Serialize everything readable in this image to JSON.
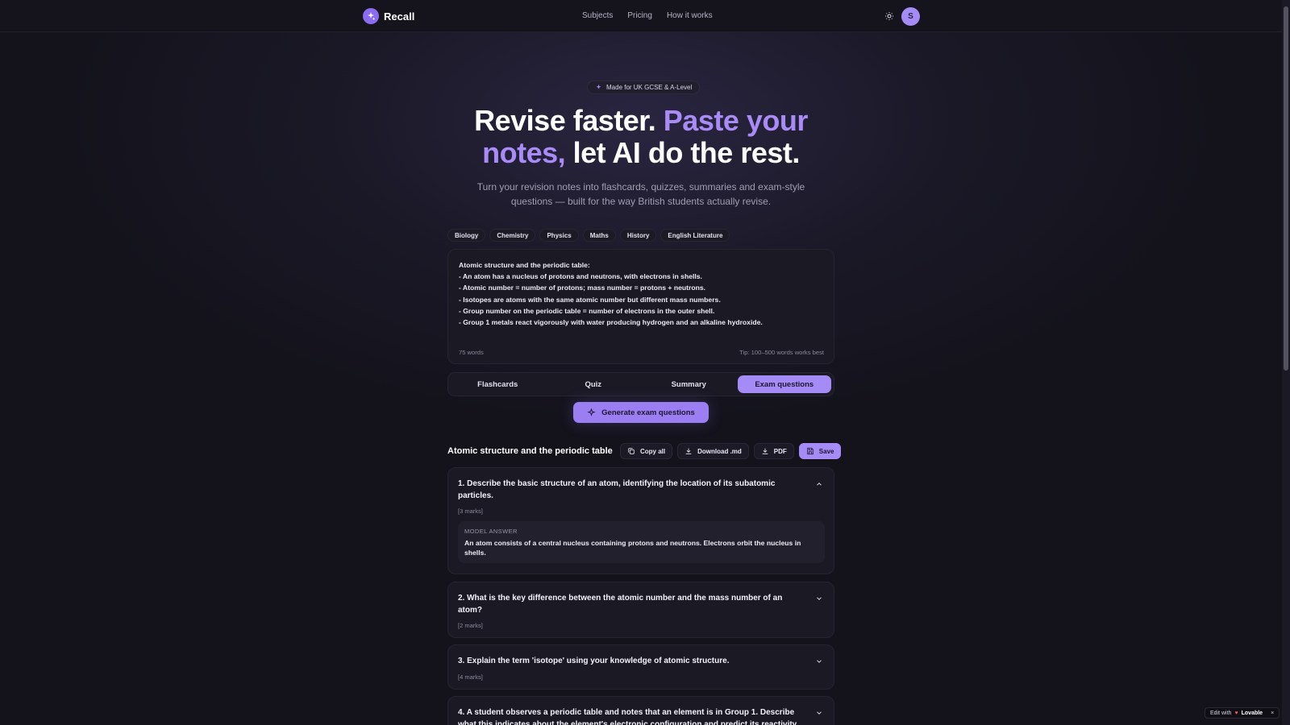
{
  "nav": {
    "brand": "Recall",
    "links": [
      "Subjects",
      "Pricing",
      "How it works"
    ],
    "avatar_initial": "S"
  },
  "hero": {
    "badge": "Made for UK GCSE & A-Level",
    "headline_part1": "Revise faster.",
    "headline_accent": "Paste your notes,",
    "headline_part2": "let AI do the rest.",
    "subhead": "Turn your revision notes into flashcards, quizzes, summaries and exam-style questions — built for the way British students actually revise."
  },
  "subjects": [
    "Biology",
    "Chemistry",
    "Physics",
    "Maths",
    "History",
    "English Literature"
  ],
  "notes": {
    "lines": [
      "Atomic structure and the periodic table:",
      "- An atom has a nucleus of protons and neutrons, with electrons in shells.",
      "- Atomic number = number of protons; mass number = protons + neutrons.",
      "- Isotopes are atoms with the same atomic number but different mass numbers.",
      "- Group number on the periodic table = number of electrons in the outer shell.",
      "- Group 1 metals react vigorously with water producing hydrogen and an alkaline hydroxide."
    ],
    "word_count": "75 words",
    "tip": "Tip: 100–500 words works best"
  },
  "modes": {
    "tabs": [
      "Flashcards",
      "Quiz",
      "Summary",
      "Exam questions"
    ],
    "active": "Exam questions"
  },
  "generate_label": "Generate exam questions",
  "results": {
    "title": "Atomic structure and the periodic table",
    "actions": {
      "copy": "Copy all",
      "download": "Download .md",
      "pdf": "PDF",
      "save": "Save"
    },
    "questions": [
      {
        "text": "1. Describe the basic structure of an atom, identifying the location of its subatomic particles.",
        "marks": "[3 marks]",
        "expanded": true,
        "model_label": "MODEL ANSWER",
        "model_answer": "An atom consists of a central nucleus containing protons and neutrons. Electrons orbit the nucleus in shells."
      },
      {
        "text": "2. What is the key difference between the atomic number and the mass number of an atom?",
        "marks": "[2 marks]",
        "expanded": false
      },
      {
        "text": "3. Explain the term 'isotope' using your knowledge of atomic structure.",
        "marks": "[4 marks]",
        "expanded": false
      },
      {
        "text": "4. A student observes a periodic table and notes that an element is in Group 1. Describe what this indicates about the element's electronic configuration and predict its reactivity",
        "expanded": false
      }
    ]
  },
  "lovable": {
    "prefix": "Edit with",
    "brand": "Lovable",
    "close": "×"
  },
  "colors": {
    "accent": "#a58bf6",
    "background": "#14131c",
    "card": "#1a1924"
  }
}
